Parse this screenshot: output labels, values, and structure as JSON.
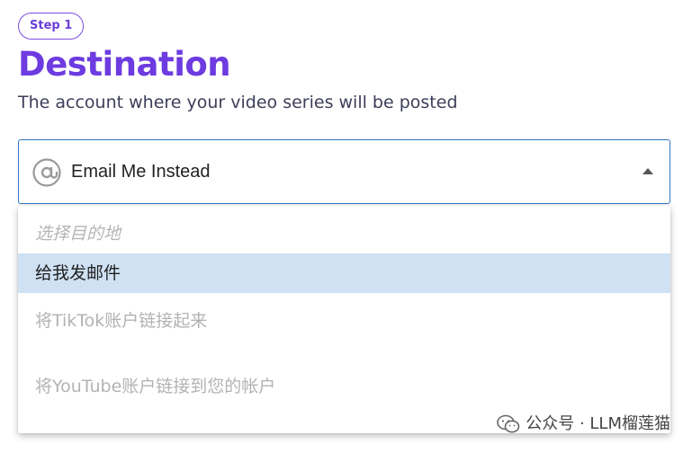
{
  "step_badge": "Step 1",
  "title": "Destination",
  "subtitle": "The account where your video series will be posted",
  "select": {
    "value": "Email Me Instead",
    "icon": "at-sign-icon",
    "expanded": true
  },
  "dropdown": {
    "placeholder": "选择目的地",
    "options": [
      {
        "label": "给我发邮件",
        "selected": true
      },
      {
        "label": "将TikTok账户链接起来",
        "selected": false
      },
      {
        "label": "将YouTube账户链接到您的帐户",
        "selected": false
      }
    ]
  },
  "watermark": "公众号 · LLM榴莲猫",
  "colors": {
    "accent": "#6d3be0",
    "select_border": "#2f74c0",
    "selected_option_bg": "#cfe1f3"
  }
}
